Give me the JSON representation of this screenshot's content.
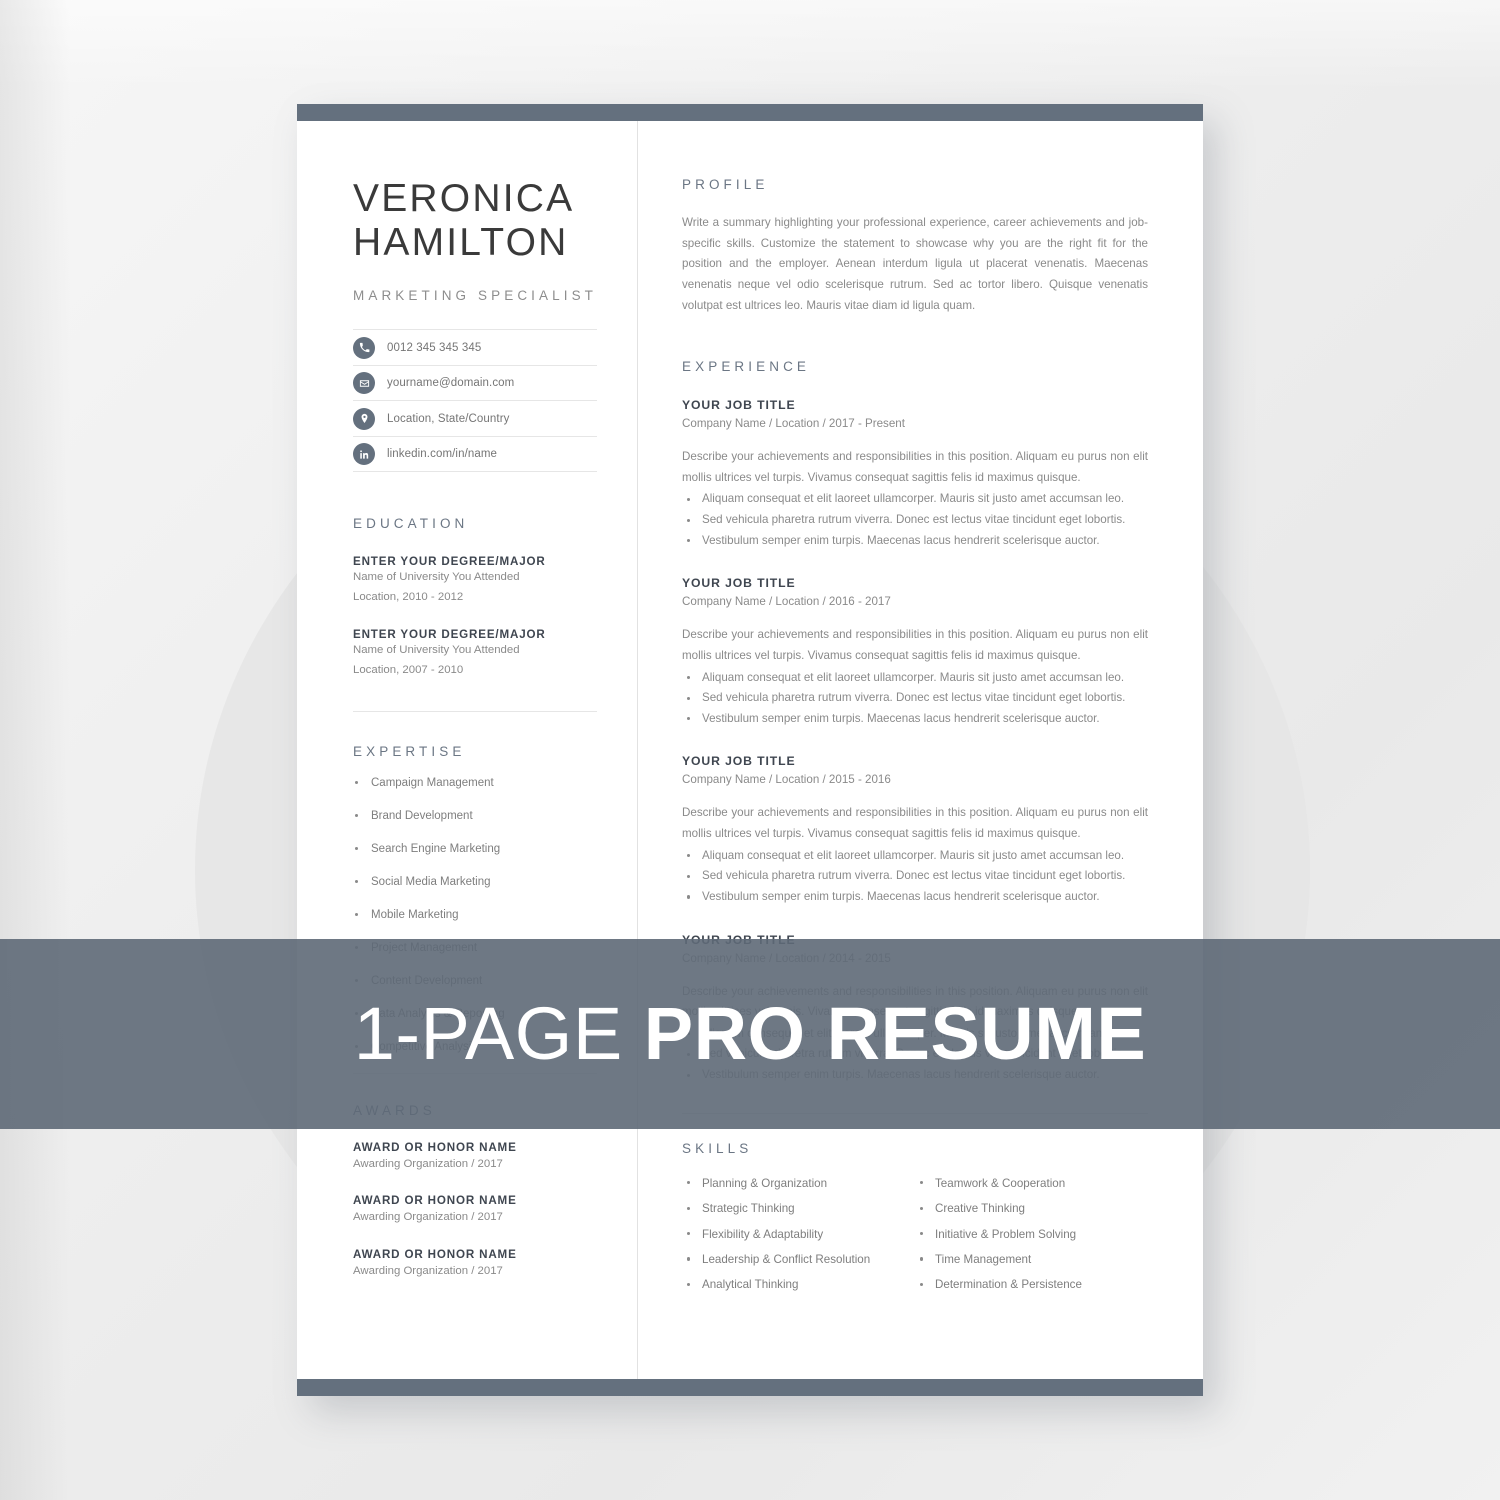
{
  "banner": {
    "light_text": "1-PAGE",
    "bold_text": "PRO RESUME",
    "bg_color": "#5e6977"
  },
  "theme": {
    "accent": "#64707e",
    "heading": "#6b7684",
    "body_text": "#8a8a8a",
    "dark_text": "#3f4650",
    "page_bg": "#ffffff"
  },
  "header": {
    "first_name": "VERONICA",
    "last_name": "HAMILTON",
    "role": "MARKETING SPECIALIST"
  },
  "contact": {
    "items": [
      {
        "icon": "phone-icon",
        "value": "0012 345 345 345"
      },
      {
        "icon": "envelope-icon",
        "value": "yourname@domain.com"
      },
      {
        "icon": "location-pin-icon",
        "value": "Location, State/Country"
      },
      {
        "icon": "linkedin-icon",
        "value": "linkedin.com/in/name"
      }
    ]
  },
  "education": {
    "heading": "EDUCATION",
    "entries": [
      {
        "degree": "ENTER YOUR DEGREE/MAJOR",
        "school": "Name of University You Attended",
        "location": "Location, 2010 - 2012"
      },
      {
        "degree": "ENTER YOUR DEGREE/MAJOR",
        "school": "Name of University You Attended",
        "location": "Location, 2007 - 2010"
      }
    ]
  },
  "expertise": {
    "heading": "EXPERTISE",
    "items": [
      "Campaign Management",
      "Brand Development",
      "Search Engine Marketing",
      "Social Media Marketing",
      "Mobile Marketing",
      "Project Management",
      "Content Development",
      "Data Analysis & Reporting",
      "Competitive Analysis"
    ]
  },
  "awards": {
    "heading": "AWARDS",
    "entries": [
      {
        "name": "AWARD OR HONOR NAME",
        "org": "Awarding Organization / 2017"
      },
      {
        "name": "AWARD OR HONOR NAME",
        "org": "Awarding Organization / 2017"
      },
      {
        "name": "AWARD OR HONOR NAME",
        "org": "Awarding Organization / 2017"
      }
    ]
  },
  "profile": {
    "heading": "PROFILE",
    "text": "Write a summary highlighting your professional experience, career achievements and job-specific skills. Customize the statement to showcase why you are the right fit for the position and the employer. Aenean interdum ligula ut placerat venenatis. Maecenas venenatis neque vel odio scelerisque rutrum. Sed ac tortor libero. Quisque venenatis volutpat est ultrices leo. Mauris vitae diam id ligula quam."
  },
  "experience": {
    "heading": "EXPERIENCE",
    "entries": [
      {
        "title": "YOUR JOB TITLE",
        "meta": "Company Name / Location / 2017 - Present",
        "description": "Describe your achievements and responsibilities in this position. Aliquam eu purus non elit mollis ultrices vel turpis. Vivamus consequat sagittis felis id maximus quisque.",
        "bullets": [
          "Aliquam consequat et elit laoreet ullamcorper. Mauris sit justo amet accumsan leo.",
          "Sed vehicula pharetra rutrum viverra. Donec est lectus vitae tincidunt eget lobortis.",
          "Vestibulum semper enim turpis. Maecenas lacus hendrerit scelerisque auctor."
        ]
      },
      {
        "title": "YOUR JOB TITLE",
        "meta": "Company Name / Location / 2016 - 2017",
        "description": "Describe your achievements and responsibilities in this position. Aliquam eu purus non elit mollis ultrices vel turpis. Vivamus consequat sagittis felis id maximus quisque.",
        "bullets": [
          "Aliquam consequat et elit laoreet ullamcorper. Mauris sit justo amet accumsan leo.",
          "Sed vehicula pharetra rutrum viverra. Donec est lectus vitae tincidunt eget lobortis.",
          "Vestibulum semper enim turpis. Maecenas lacus hendrerit scelerisque auctor."
        ]
      },
      {
        "title": "YOUR JOB TITLE",
        "meta": "Company Name / Location / 2015 - 2016",
        "description": "Describe your achievements and responsibilities in this position. Aliquam eu purus non elit mollis ultrices vel turpis. Vivamus consequat sagittis felis id maximus quisque.",
        "bullets": [
          "Aliquam consequat et elit laoreet ullamcorper. Mauris sit justo amet accumsan leo.",
          "Sed vehicula pharetra rutrum viverra. Donec est lectus vitae tincidunt eget lobortis.",
          "Vestibulum semper enim turpis. Maecenas lacus hendrerit scelerisque auctor."
        ]
      },
      {
        "title": "YOUR JOB TITLE",
        "meta": "Company Name / Location / 2014 - 2015",
        "description": "Describe your achievements and responsibilities in this position. Aliquam eu purus non elit mollis ultrices vel turpis. Vivamus consequat sagittis felis id maximus quisque.",
        "bullets": [
          "Aliquam consequat et elit laoreet ullamcorper. Mauris sit justo amet accumsan leo.",
          "Sed vehicula pharetra rutrum viverra. Donec est lectus vitae tincidunt eget lobortis.",
          "Vestibulum semper enim turpis. Maecenas lacus hendrerit scelerisque auctor."
        ]
      }
    ]
  },
  "skills": {
    "heading": "SKILLS",
    "column_left": [
      "Planning & Organization",
      "Strategic Thinking",
      "Flexibility & Adaptability",
      "Leadership & Conflict Resolution",
      "Analytical Thinking"
    ],
    "column_right": [
      "Teamwork & Cooperation",
      "Creative Thinking",
      "Initiative & Problem Solving",
      "Time Management",
      "Determination & Persistence"
    ]
  }
}
